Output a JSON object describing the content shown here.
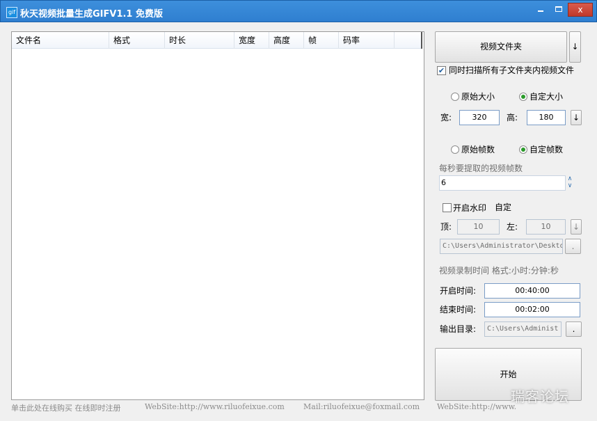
{
  "window": {
    "icon_text": "gif",
    "title": "秋天视频批量生成GIFV1.1 免费版",
    "min_glyph": "–",
    "max_glyph": "□",
    "close_glyph": "x"
  },
  "file_list": {
    "columns": [
      "文件名",
      "格式",
      "时长",
      "宽度",
      "高度",
      "帧",
      "码率"
    ],
    "rows": []
  },
  "folder": {
    "button_label": "视频文件夹",
    "dropdown_glyph": "↓",
    "scan_subfolders_label": "同时扫描所有子文件夹内视频文件",
    "scan_subfolders_checked": true
  },
  "size": {
    "original_label": "原始大小",
    "custom_label": "自定大小",
    "selected": "custom",
    "width_label": "宽:",
    "width_value": "320",
    "height_label": "高:",
    "height_value": "180",
    "arrow_glyph": "↓"
  },
  "frames": {
    "original_label": "原始帧数",
    "custom_label": "自定帧数",
    "selected": "custom",
    "fps_label": "每秒要提取的视频帧数",
    "fps_value": "6",
    "spin_up": "∧",
    "spin_down": "∨"
  },
  "watermark": {
    "enable_label": "开启水印",
    "enabled": false,
    "custom_label": "自定",
    "top_label": "顶:",
    "top_value": "10",
    "left_label": "左:",
    "left_value": "10",
    "arrow_glyph": "↓",
    "path_value": "C:\\Users\\Administrator\\Deskto",
    "browse_label": "."
  },
  "record_time": {
    "heading": "视频录制时间 格式:小时:分钟:秒",
    "start_label": "开启时间:",
    "start_value": "00:40:00",
    "end_label": "结束时间:",
    "end_value": "00:02:00"
  },
  "output": {
    "label": "输出目录:",
    "path_value": "C:\\Users\\Administ",
    "browse_label": "."
  },
  "start_button_label": "开始",
  "footer": {
    "buy_register": "单击此处在线购买 在线即时注册",
    "website": "WebSite:http://www.riluofeixue.com",
    "mail": "Mail:riluofeixue@foxmail.com",
    "website2": "WebSite:http://www."
  },
  "overlay_watermark": "瑞客论坛"
}
